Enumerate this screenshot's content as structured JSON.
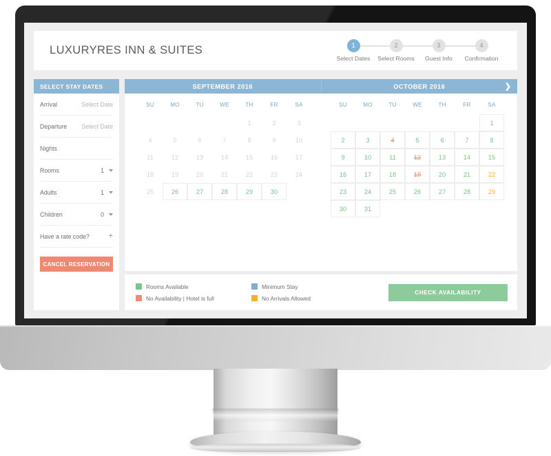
{
  "header": {
    "hotel_name": "LUXURYRES INN & SUITES",
    "steps": [
      {
        "number": "1",
        "label": "Select Dates"
      },
      {
        "number": "2",
        "label": "Select Rooms"
      },
      {
        "number": "3",
        "label": "Guest Info"
      },
      {
        "number": "4",
        "label": "Confirmation"
      }
    ]
  },
  "sidebar": {
    "title": "SELECT STAY DATES",
    "fields": [
      {
        "label": "Arrival",
        "value": "Select Date",
        "control": "none"
      },
      {
        "label": "Departure",
        "value": "Select Date",
        "control": "none"
      },
      {
        "label": "Nights",
        "value": "",
        "control": "none"
      },
      {
        "label": "Rooms",
        "value": "1",
        "control": "select"
      },
      {
        "label": "Adults",
        "value": "1",
        "control": "select"
      },
      {
        "label": "Children",
        "value": "0",
        "control": "select"
      },
      {
        "label": "Have a rate code?",
        "value": "+",
        "control": "expand"
      }
    ],
    "cancel_label": "CANCEL RESERVATION"
  },
  "calendar": {
    "next_arrow": "❯",
    "weekdays": [
      "SU",
      "MO",
      "TU",
      "WE",
      "TH",
      "FR",
      "SA"
    ],
    "months": [
      {
        "title": "SEPTEMBER 2016",
        "weeks": [
          [
            {
              "d": "",
              "s": "empty"
            },
            {
              "d": "",
              "s": "empty"
            },
            {
              "d": "",
              "s": "empty"
            },
            {
              "d": "",
              "s": "empty"
            },
            {
              "d": "1",
              "s": "past"
            },
            {
              "d": "2",
              "s": "past"
            },
            {
              "d": "3",
              "s": "past"
            }
          ],
          [
            {
              "d": "4",
              "s": "past"
            },
            {
              "d": "5",
              "s": "past"
            },
            {
              "d": "6",
              "s": "past"
            },
            {
              "d": "7",
              "s": "past"
            },
            {
              "d": "8",
              "s": "past"
            },
            {
              "d": "9",
              "s": "past"
            },
            {
              "d": "10",
              "s": "past"
            }
          ],
          [
            {
              "d": "11",
              "s": "past"
            },
            {
              "d": "12",
              "s": "past"
            },
            {
              "d": "13",
              "s": "past"
            },
            {
              "d": "14",
              "s": "past"
            },
            {
              "d": "15",
              "s": "past"
            },
            {
              "d": "16",
              "s": "past"
            },
            {
              "d": "17",
              "s": "past"
            }
          ],
          [
            {
              "d": "18",
              "s": "past"
            },
            {
              "d": "19",
              "s": "past"
            },
            {
              "d": "20",
              "s": "past"
            },
            {
              "d": "21",
              "s": "past"
            },
            {
              "d": "22",
              "s": "past"
            },
            {
              "d": "23",
              "s": "past"
            },
            {
              "d": "24",
              "s": "past"
            }
          ],
          [
            {
              "d": "25",
              "s": "past"
            },
            {
              "d": "26",
              "s": "avail"
            },
            {
              "d": "27",
              "s": "avail"
            },
            {
              "d": "28",
              "s": "avail"
            },
            {
              "d": "29",
              "s": "avail"
            },
            {
              "d": "30",
              "s": "avail"
            },
            {
              "d": "",
              "s": "empty"
            }
          ],
          [
            {
              "d": "",
              "s": "empty"
            },
            {
              "d": "",
              "s": "empty"
            },
            {
              "d": "",
              "s": "empty"
            },
            {
              "d": "",
              "s": "empty"
            },
            {
              "d": "",
              "s": "empty"
            },
            {
              "d": "",
              "s": "empty"
            },
            {
              "d": "",
              "s": "empty"
            }
          ]
        ]
      },
      {
        "title": "OCTOBER 2016",
        "weeks": [
          [
            {
              "d": "",
              "s": "empty"
            },
            {
              "d": "",
              "s": "empty"
            },
            {
              "d": "",
              "s": "empty"
            },
            {
              "d": "",
              "s": "empty"
            },
            {
              "d": "",
              "s": "empty"
            },
            {
              "d": "",
              "s": "empty"
            },
            {
              "d": "1",
              "s": "avail"
            }
          ],
          [
            {
              "d": "2",
              "s": "avail"
            },
            {
              "d": "3",
              "s": "avail"
            },
            {
              "d": "4",
              "s": "full"
            },
            {
              "d": "5",
              "s": "avail"
            },
            {
              "d": "6",
              "s": "avail"
            },
            {
              "d": "7",
              "s": "avail"
            },
            {
              "d": "8",
              "s": "avail"
            }
          ],
          [
            {
              "d": "9",
              "s": "avail"
            },
            {
              "d": "10",
              "s": "avail"
            },
            {
              "d": "11",
              "s": "avail"
            },
            {
              "d": "12",
              "s": "full"
            },
            {
              "d": "13",
              "s": "avail"
            },
            {
              "d": "14",
              "s": "avail"
            },
            {
              "d": "15",
              "s": "avail"
            }
          ],
          [
            {
              "d": "16",
              "s": "avail"
            },
            {
              "d": "17",
              "s": "avail"
            },
            {
              "d": "18",
              "s": "avail"
            },
            {
              "d": "19",
              "s": "full"
            },
            {
              "d": "20",
              "s": "avail"
            },
            {
              "d": "21",
              "s": "avail"
            },
            {
              "d": "22",
              "s": "noarr"
            }
          ],
          [
            {
              "d": "23",
              "s": "avail"
            },
            {
              "d": "24",
              "s": "avail"
            },
            {
              "d": "25",
              "s": "avail"
            },
            {
              "d": "26",
              "s": "avail"
            },
            {
              "d": "27",
              "s": "avail"
            },
            {
              "d": "28",
              "s": "avail"
            },
            {
              "d": "29",
              "s": "noarr"
            }
          ],
          [
            {
              "d": "30",
              "s": "avail"
            },
            {
              "d": "31",
              "s": "avail"
            },
            {
              "d": "",
              "s": "empty"
            },
            {
              "d": "",
              "s": "empty"
            },
            {
              "d": "",
              "s": "empty"
            },
            {
              "d": "",
              "s": "empty"
            },
            {
              "d": "",
              "s": "empty"
            }
          ]
        ]
      }
    ]
  },
  "legend": {
    "items": [
      {
        "label": "Rooms Available",
        "color": "#7ac48a"
      },
      {
        "label": "Minimum Stay",
        "color": "#7fb0d4"
      },
      {
        "label": "No Availability | Hotel is full",
        "color": "#ef8b77"
      },
      {
        "label": "No Arrivals Allowed",
        "color": "#f2b335"
      }
    ],
    "check_label": "CHECK AVAILABILITY"
  },
  "colors": {
    "blue_header": "#8cb6d4",
    "green_available": "#7ac48a",
    "red_full": "#ef8b77",
    "orange_noarrival": "#f2b335",
    "coral_cancel": "#ee8873",
    "green_button": "#8ecb9b"
  }
}
